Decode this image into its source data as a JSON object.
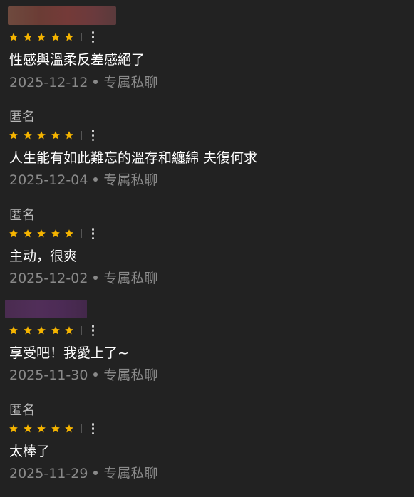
{
  "colors": {
    "background": "#222222",
    "star": "#f5b400",
    "text": "#ffffff",
    "meta": "#8a8a8a",
    "author": "#b9b9b9"
  },
  "rating_max": 5,
  "reviews": [
    {
      "author": "",
      "author_blurred": true,
      "rating": 5,
      "text": "性感與溫柔反差感絕了",
      "date": "2025-12-12",
      "category": "专属私聊"
    },
    {
      "author": "匿名",
      "author_blurred": false,
      "rating": 5,
      "text": "人生能有如此難忘的溫存和纏綿 夫復何求",
      "date": "2025-12-04",
      "category": "专属私聊"
    },
    {
      "author": "匿名",
      "author_blurred": false,
      "rating": 5,
      "text": "主动，很爽",
      "date": "2025-12-02",
      "category": "专属私聊"
    },
    {
      "author": "",
      "author_blurred": true,
      "rating": 5,
      "text": "享受吧！我愛上了~",
      "date": "2025-11-30",
      "category": "专属私聊"
    },
    {
      "author": "匿名",
      "author_blurred": false,
      "rating": 5,
      "text": "太棒了",
      "date": "2025-11-29",
      "category": "专属私聊"
    }
  ]
}
